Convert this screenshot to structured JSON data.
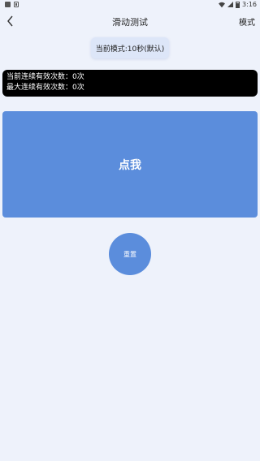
{
  "status_bar": {
    "time": "3:16"
  },
  "nav": {
    "title": "滑动测试",
    "mode_label": "模式"
  },
  "mode_badge": {
    "text": "当前模式:10秒(默认)"
  },
  "stats": {
    "current_streak": "当前连续有效次数：0次",
    "max_streak": "最大连续有效次数：0次"
  },
  "tap_area": {
    "label": "点我"
  },
  "reset": {
    "label": "重置"
  },
  "colors": {
    "accent": "#5b8ddc",
    "background": "#eef2fb",
    "stats_bg": "#000000"
  }
}
